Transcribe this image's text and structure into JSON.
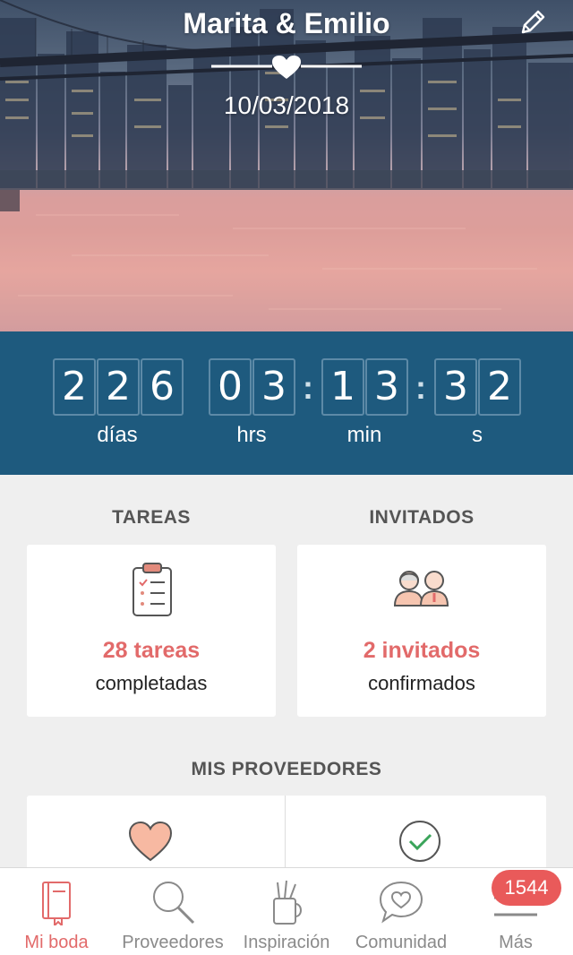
{
  "hero": {
    "couple_names": "Marita & Emilio",
    "wedding_date": "10/03/2018"
  },
  "countdown": {
    "days": [
      "2",
      "2",
      "6"
    ],
    "hours": [
      "0",
      "3"
    ],
    "minutes": [
      "1",
      "3"
    ],
    "seconds": [
      "3",
      "2"
    ],
    "separator": ":",
    "labels": {
      "days": "días",
      "hours": "hrs",
      "minutes": "min",
      "seconds": "s"
    }
  },
  "tasks": {
    "title": "TAREAS",
    "count": "28 tareas",
    "sub": "completadas",
    "icon": "clipboard-checklist-icon"
  },
  "guests": {
    "title": "INVITADOS",
    "count": "2 invitados",
    "sub": "confirmados",
    "icon": "couple-guests-icon"
  },
  "vendors": {
    "title": "MIS PROVEEDORES",
    "left_icon": "heart-icon",
    "right_icon": "check-circle-icon"
  },
  "tabbar": {
    "items": [
      {
        "label": "Mi boda",
        "icon": "notebook-icon",
        "active": true
      },
      {
        "label": "Proveedores",
        "icon": "search-icon",
        "active": false
      },
      {
        "label": "Inspiración",
        "icon": "pencil-cup-icon",
        "active": false
      },
      {
        "label": "Comunidad",
        "icon": "chat-heart-icon",
        "active": false
      },
      {
        "label": "Más",
        "icon": "menu-icon",
        "active": false
      }
    ],
    "badge": "1544"
  },
  "colors": {
    "accent": "#e26a6a",
    "countdown_bg": "#1e5a7e",
    "badge": "#e95a5a"
  }
}
